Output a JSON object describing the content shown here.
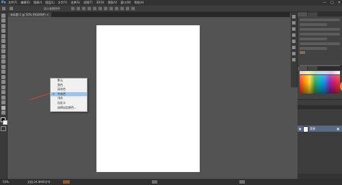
{
  "menubar": {
    "logo": "Ps",
    "items": [
      "文件(F)",
      "编辑(E)",
      "图像(I)",
      "图层(L)",
      "文字(Y)",
      "选择(S)",
      "滤镜(T)",
      "3D(D)",
      "视图(V)",
      "窗口(W)",
      "帮助(H)"
    ],
    "window_controls": [
      "—",
      "□",
      "✕"
    ]
  },
  "options_bar": {
    "label": "显示变换控件"
  },
  "document_tab": {
    "title": "未标题-1 @ 50% (RGB/8#) ×"
  },
  "context_menu": {
    "items": [
      {
        "label": "默认",
        "checked": false
      },
      {
        "label": "黑色",
        "checked": false
      },
      {
        "label": "深灰色",
        "checked": false
      },
      {
        "label": "中灰色",
        "checked": true
      },
      {
        "label": "浅灰",
        "checked": false
      },
      {
        "label": "自定义",
        "checked": false
      },
      {
        "label": "选择自定颜色...",
        "checked": false
      }
    ],
    "highlighted_index": 3
  },
  "layers_panel": {
    "layer_name": "背景",
    "eye_icon": "eye-icon",
    "lock_icon": "lock-icon"
  },
  "statusbar": {
    "zoom": "50%",
    "doc_info": "文档:24.9M/0字节"
  },
  "colors": {
    "canvas_bg": "#535353",
    "highlight": "#9fc3e9",
    "arrow": "#d0453b"
  }
}
